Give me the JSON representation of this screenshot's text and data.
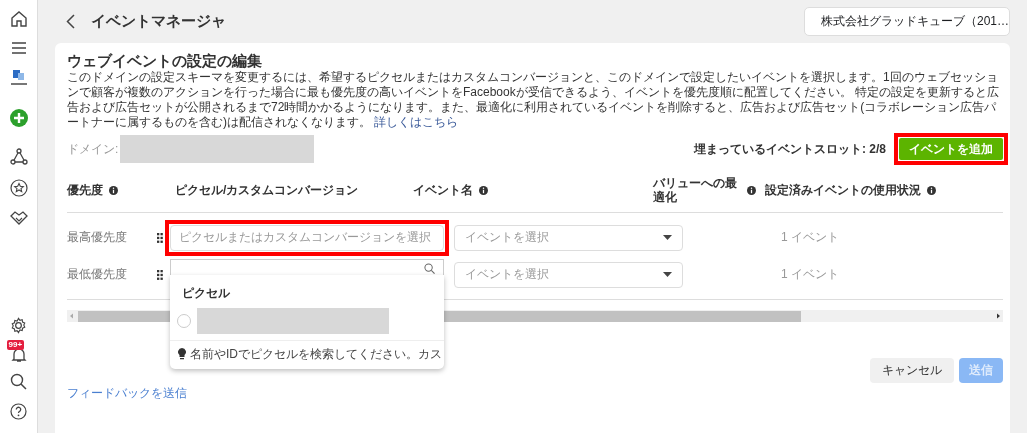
{
  "sidebar": {
    "notification_badge": "99+"
  },
  "header": {
    "title": "イベントマネージャ",
    "account": "株式会社グラッドキューブ（201…"
  },
  "card": {
    "title": "ウェブイベントの設定の編集",
    "description": "このドメインの設定スキーマを変更するには、希望するピクセルまたはカスタムコンバージョンと、このドメインで設定したいイベントを選択します。1回のウェブセッションで顧客が複数のアクションを行った場合に最も優先度の高いイベントをFacebookが受信できるよう、イベントを優先度順に配置してください。 特定の設定を更新すると広告および広告セットが公開されるまで72時間かかるようになります。また、最適化に利用されているイベントを削除すると、広告および広告セット(コラボレーション広告パートナーに属するものを含む)は配信されなくなります。",
    "link": "詳しくはこちら",
    "domain_label": "ドメイン:",
    "slots": "埋まっているイベントスロット: 2/8",
    "add_button": {
      "label": "イベントを追加",
      "highlighted": true
    }
  },
  "table": {
    "columns": [
      {
        "label": "優先度",
        "info": true
      },
      {
        "label": "ピクセル/カスタムコンバージョン",
        "info": false
      },
      {
        "label": "イベント名",
        "info": true
      },
      {
        "label": "バリューへの最適化",
        "info": true
      },
      {
        "label": "設定済みイベントの使用状況",
        "info": true
      }
    ],
    "rows": [
      {
        "priority": "最高優先度",
        "pixel_select": {
          "placeholder": "ピクセルまたはカスタムコンバージョンを選択",
          "expanded": false,
          "highlighted": true
        },
        "event_select": {
          "placeholder": "イベントを選択"
        },
        "usage": "1 イベント"
      },
      {
        "priority": "最低優先度",
        "pixel_select": {
          "expanded": true
        },
        "event_select": {
          "placeholder": "イベントを選択"
        },
        "usage": "1 イベント"
      }
    ]
  },
  "dropdown": {
    "section": "ピクセル",
    "options": [
      {
        "selected": false
      }
    ],
    "hint": "名前やIDでピクセルを検索してください。カス"
  },
  "footer": {
    "cancel": "キャンセル",
    "submit": {
      "label": "送信",
      "disabled": true
    },
    "feedback": "フィードバックを送信"
  }
}
